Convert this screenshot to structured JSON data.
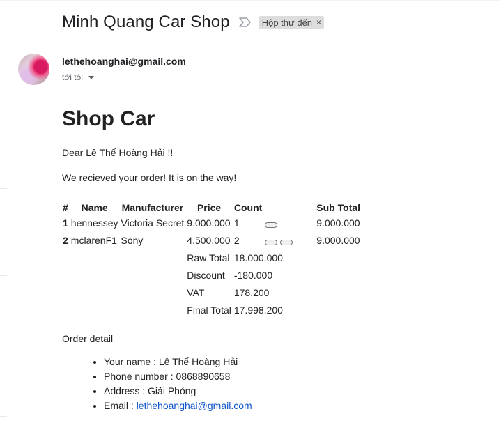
{
  "subject": "Minh Quang Car Shop",
  "label_chip": {
    "text": "Hộp thư đến",
    "close": "×"
  },
  "sender": {
    "email": "lethehoanghai@gmail.com",
    "to": "tới tôi"
  },
  "email_body": {
    "title": "Shop Car",
    "greeting": "Dear Lê Thế Hoàng Hải !!",
    "message": "We recieved your order! It is on the way!",
    "table": {
      "headers": [
        "#",
        "Name",
        "Manufacturer",
        "Price",
        "Count",
        "",
        "Sub Total"
      ],
      "rows": [
        {
          "idx": "1",
          "name": "hennessey",
          "manufacturer": "Victoria Secret",
          "price": "9.000.000",
          "count": "1",
          "buttons": 1,
          "subtotal": "9.000.000"
        },
        {
          "idx": "2",
          "name": "mclarenF1",
          "manufacturer": "Sony",
          "price": "4.500.000",
          "count": "2",
          "buttons": 2,
          "subtotal": "9.000.000"
        }
      ],
      "summary": [
        {
          "label": "Raw Total",
          "value": "18.000.000"
        },
        {
          "label": "Discount",
          "value": "-180.000"
        },
        {
          "label": "VAT",
          "value": "178.200"
        },
        {
          "label": "Final Total",
          "value": "17.998.200"
        }
      ]
    },
    "order_detail_title": "Order detail",
    "details": {
      "name": "Your name : Lê Thế Hoàng Hải",
      "phone": "Phone number : 0868890658",
      "address": "Address : Giải Phóng",
      "email_label": "Email : ",
      "email_link": "lethehoanghai@gmail.com"
    }
  }
}
